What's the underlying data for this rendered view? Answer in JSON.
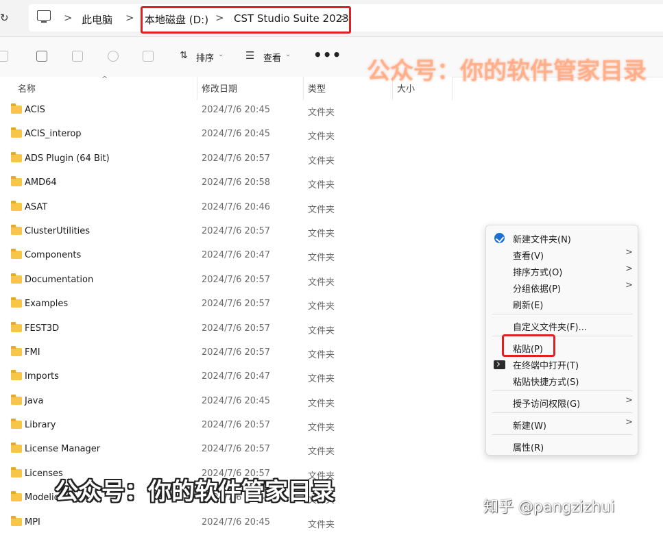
{
  "addressbar": {
    "refresh_glyph": "↻",
    "crumbs": [
      "此电脑",
      "本地磁盘 (D:)",
      "CST Studio Suite 2023"
    ],
    "chevron": ">"
  },
  "toolbar": {
    "sort_label": "排序",
    "view_label": "查看",
    "more_label": "•••",
    "caret": "⌄"
  },
  "columns": {
    "name": "名称",
    "date": "修改日期",
    "type": "类型",
    "size": "大小",
    "sort_indicator": "^"
  },
  "files": [
    {
      "name": "ACIS",
      "date": "2024/7/6 20:45",
      "type": "文件夹"
    },
    {
      "name": "ACIS_interop",
      "date": "2024/7/6 20:45",
      "type": "文件夹"
    },
    {
      "name": "ADS Plugin (64 Bit)",
      "date": "2024/7/6 20:57",
      "type": "文件夹"
    },
    {
      "name": "AMD64",
      "date": "2024/7/6 20:58",
      "type": "文件夹"
    },
    {
      "name": "ASAT",
      "date": "2024/7/6 20:46",
      "type": "文件夹"
    },
    {
      "name": "ClusterUtilities",
      "date": "2024/7/6 20:57",
      "type": "文件夹"
    },
    {
      "name": "Components",
      "date": "2024/7/6 20:47",
      "type": "文件夹"
    },
    {
      "name": "Documentation",
      "date": "2024/7/6 20:57",
      "type": "文件夹"
    },
    {
      "name": "Examples",
      "date": "2024/7/6 20:57",
      "type": "文件夹"
    },
    {
      "name": "FEST3D",
      "date": "2024/7/6 20:57",
      "type": "文件夹"
    },
    {
      "name": "FMI",
      "date": "2024/7/6 20:57",
      "type": "文件夹"
    },
    {
      "name": "Imports",
      "date": "2024/7/6 20:47",
      "type": "文件夹"
    },
    {
      "name": "Java",
      "date": "2024/7/6 20:45",
      "type": "文件夹"
    },
    {
      "name": "Library",
      "date": "2024/7/6 20:57",
      "type": "文件夹"
    },
    {
      "name": "License Manager",
      "date": "2024/7/6 20:57",
      "type": "文件夹"
    },
    {
      "name": "Licenses",
      "date": "2024/7/6 20:57",
      "type": "文件夹"
    },
    {
      "name": "Modelica",
      "date": "2024/7/6 20:4",
      "type": "文件夹"
    },
    {
      "name": "MPI",
      "date": "2024/7/6 20:45",
      "type": "文件夹"
    }
  ],
  "context_menu": {
    "submenu_arrow": ">",
    "new_folder": "新建文件夹(N)",
    "view": "查看(V)",
    "sort_by": "排序方式(O)",
    "group_by": "分组依据(P)",
    "refresh": "刷新(E)",
    "customize": "自定义文件夹(F)...",
    "paste": "粘贴(P)",
    "open_terminal": "在终端中打开(T)",
    "paste_shortcut": "粘贴快捷方式(S)",
    "grant_access": "授予访问权限(G)",
    "new": "新建(W)",
    "properties": "属性(R)"
  },
  "watermarks": {
    "top": "公众号：你的软件管家目录",
    "bottom": "公众号：你的软件管家目录",
    "zhihu": "知乎 @pangzizhui"
  },
  "colors": {
    "highlight_red": "#e0201e",
    "folder_yellow": "#f7c646",
    "accent_blue": "#1a6fd1"
  }
}
